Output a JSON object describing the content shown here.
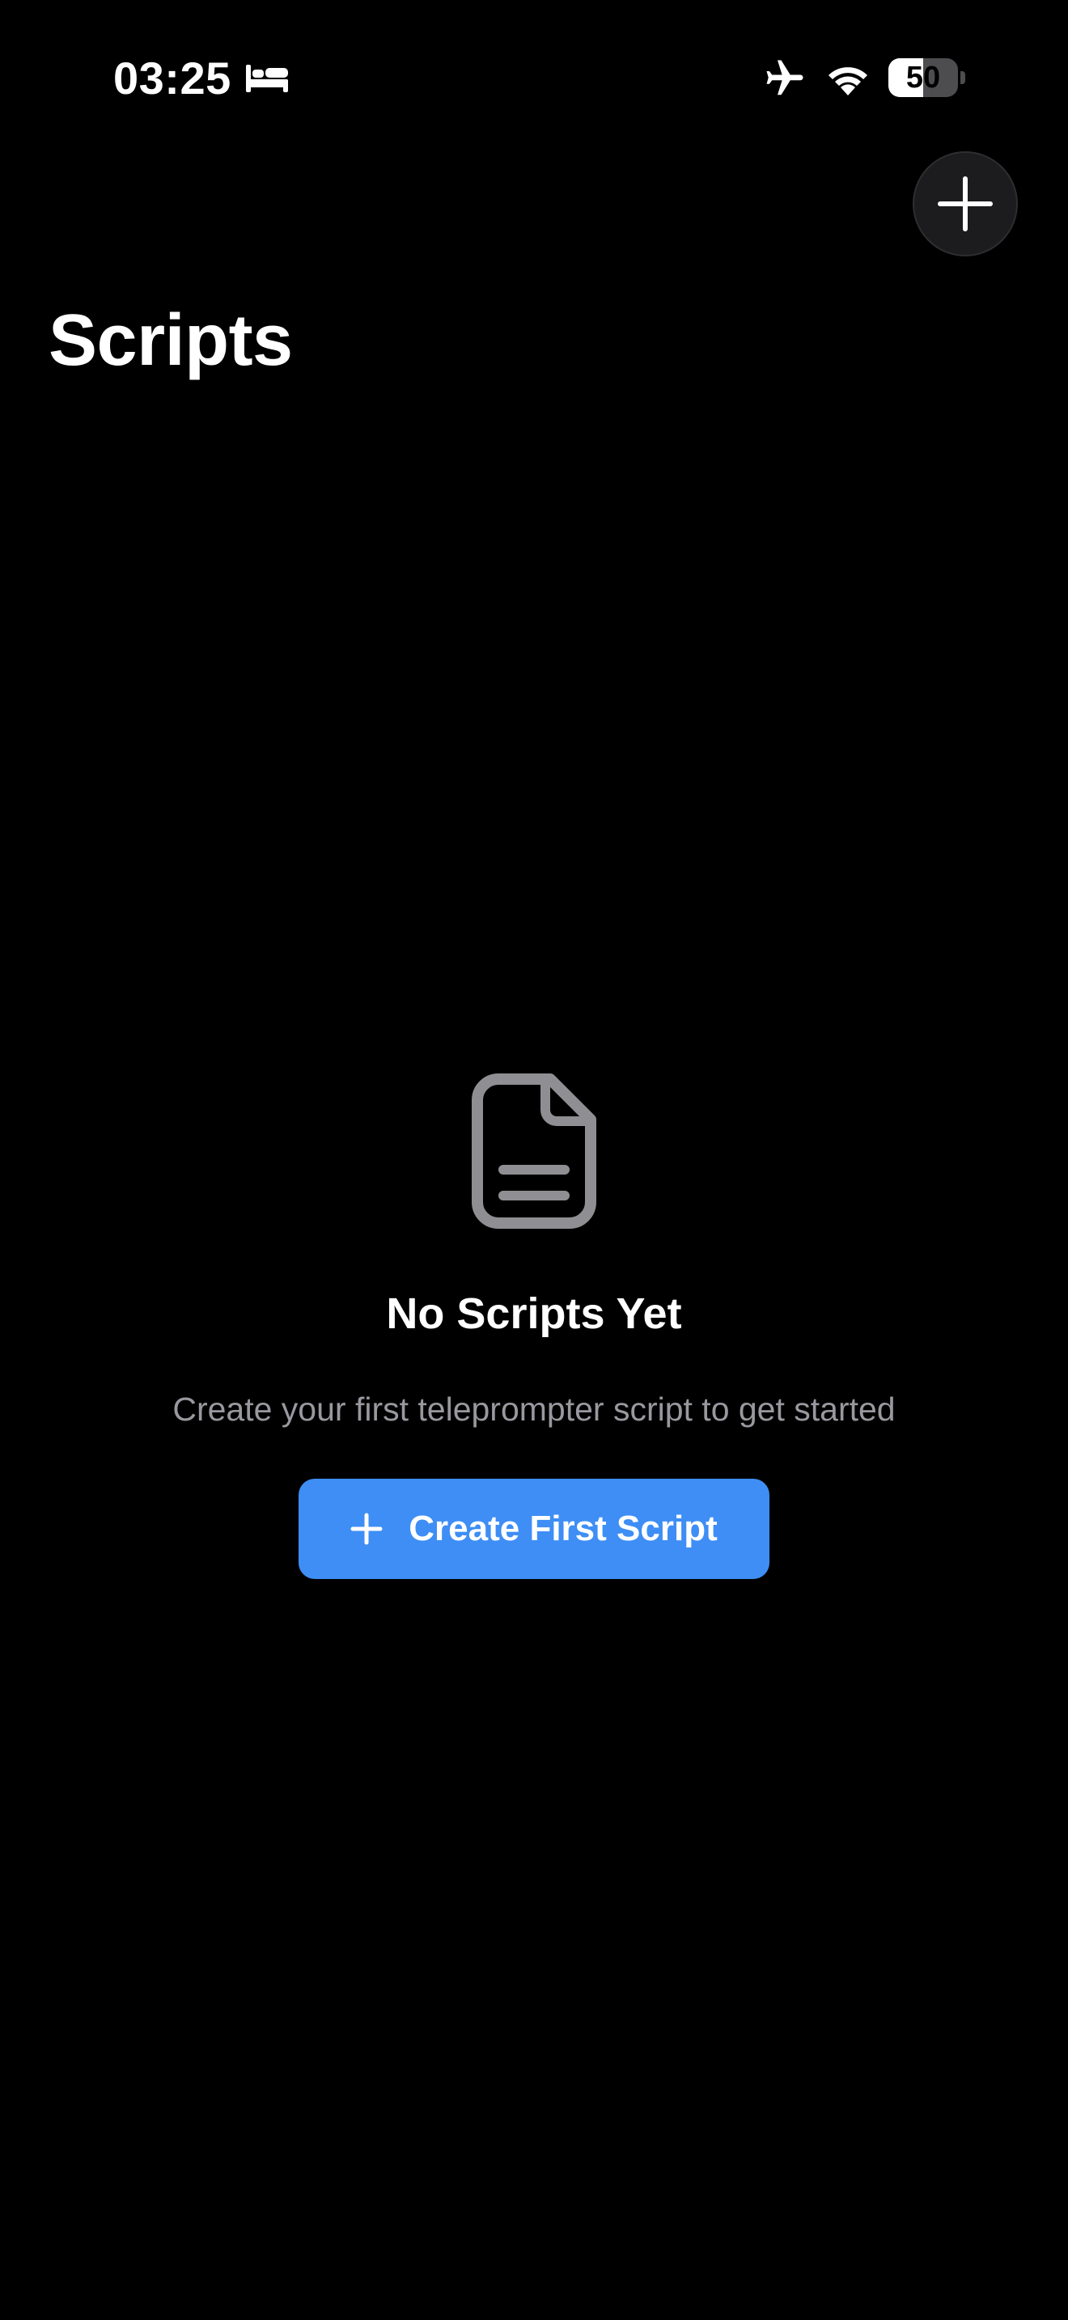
{
  "status_bar": {
    "time": "03:25",
    "battery_level": "50",
    "battery_fraction": 0.5,
    "icons": [
      "sleep-focus-icon",
      "airplane-mode-icon",
      "wifi-icon",
      "battery-icon"
    ]
  },
  "header": {
    "title": "Scripts",
    "add_button_icon": "plus-icon"
  },
  "empty_state": {
    "icon": "document-icon",
    "title": "No Scripts Yet",
    "subtitle": "Create your first teleprompter script to get started",
    "button_icon": "plus-icon",
    "button_label": "Create First Script"
  },
  "colors": {
    "background": "#000000",
    "accent": "#3E8EF5",
    "secondary_text": "#98989F",
    "icon_gray": "#8E8E93",
    "button_surface": "#1C1C1E"
  }
}
